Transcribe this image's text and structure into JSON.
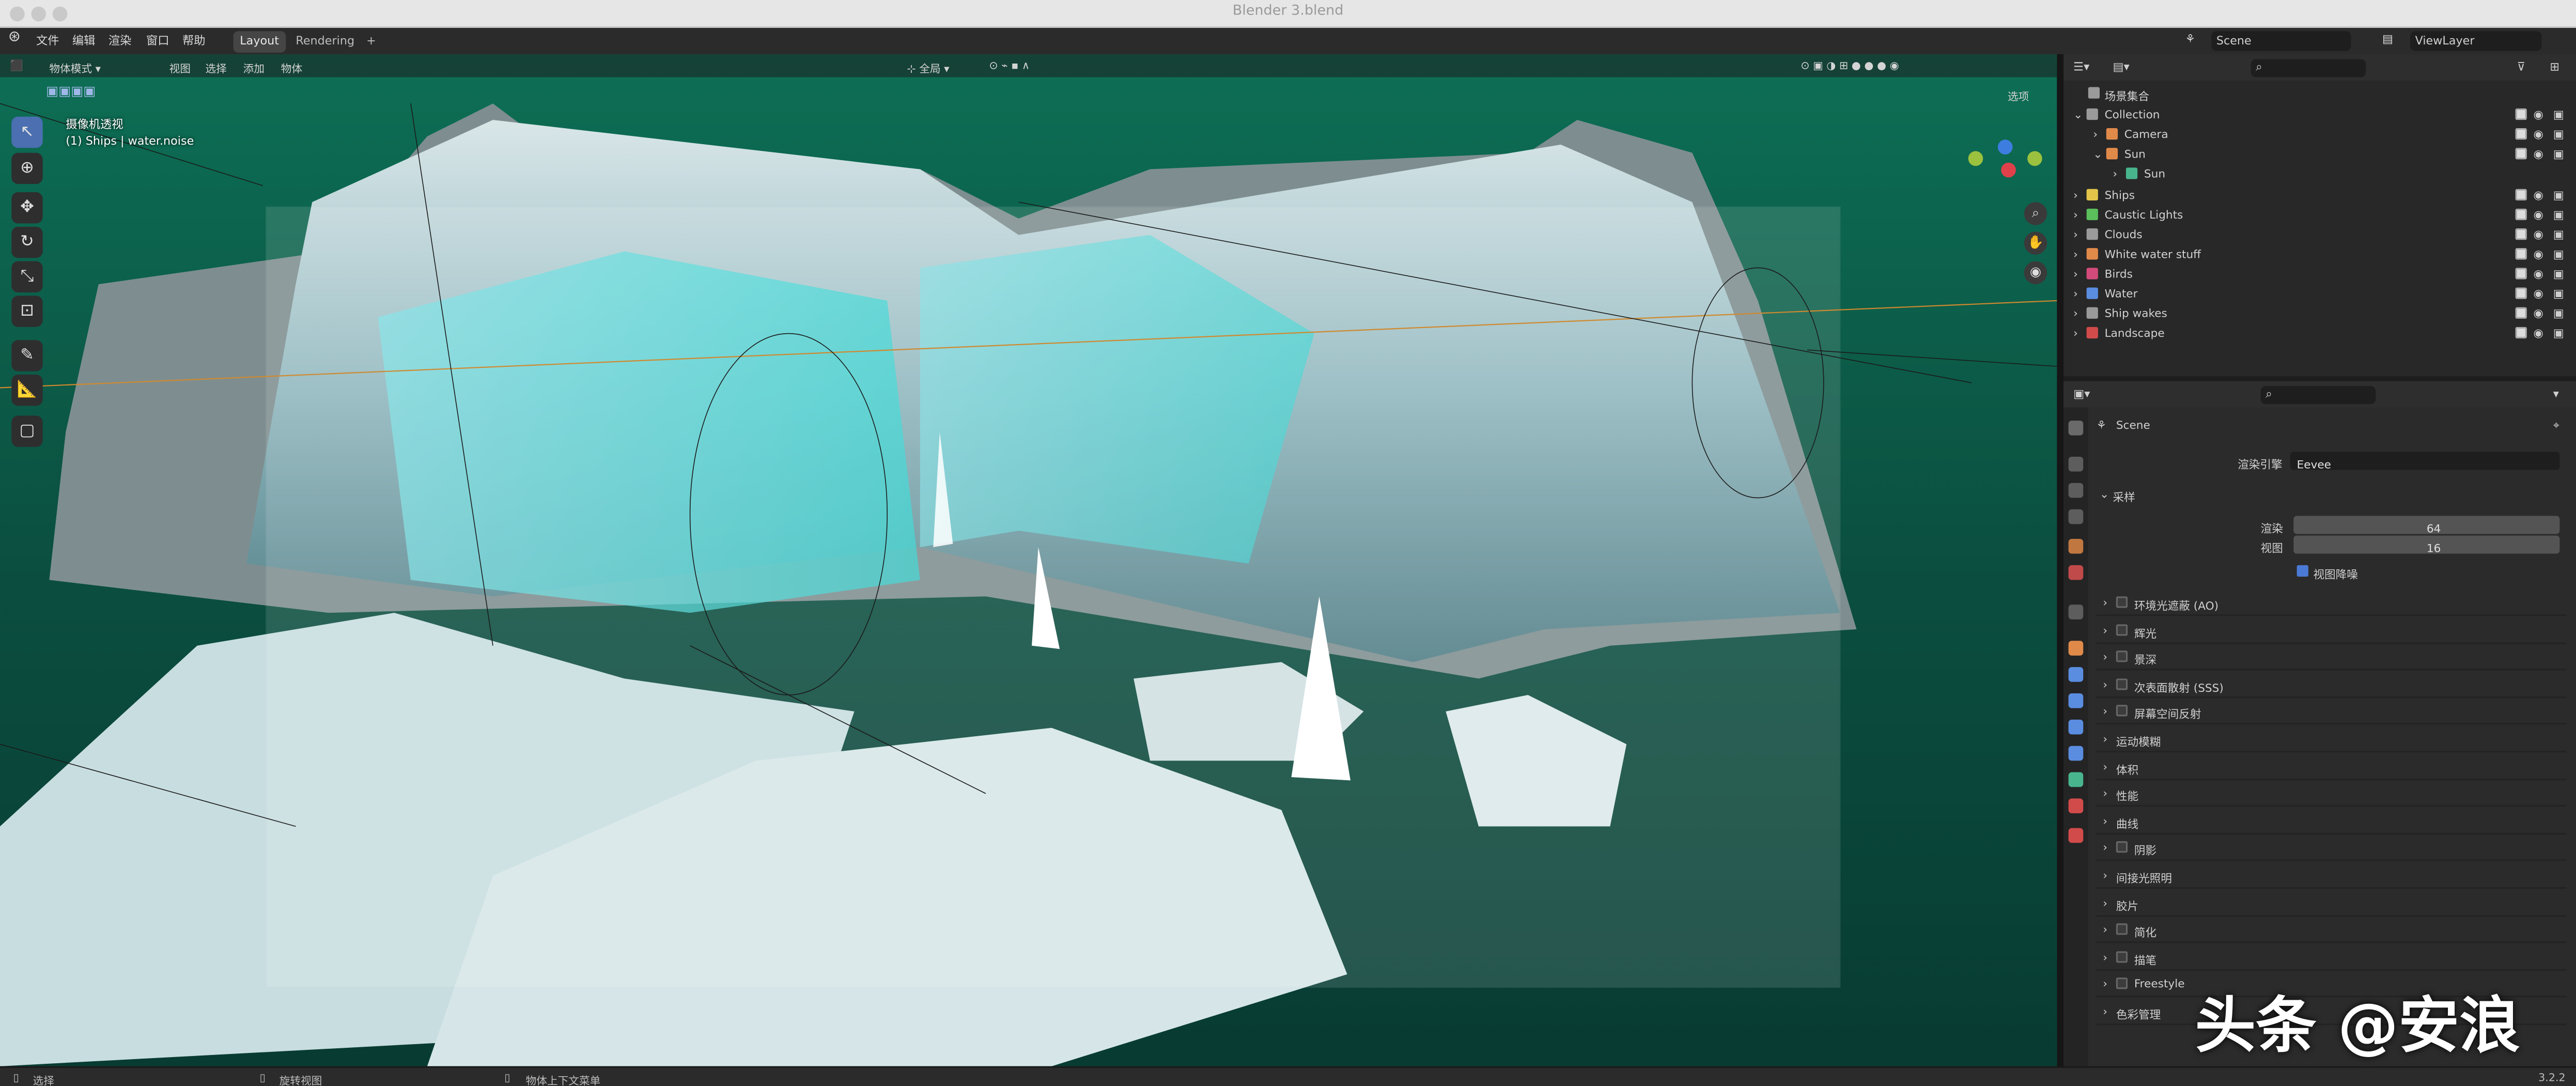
{
  "window": {
    "title": "Blender 3.blend"
  },
  "topbar": {
    "menus": [
      "文件",
      "编辑",
      "渲染",
      "窗口",
      "帮助"
    ],
    "tabs": [
      "Layout",
      "Rendering"
    ],
    "add_tab": "+",
    "scene": "Scene",
    "view_layer": "ViewLayer"
  },
  "viewport": {
    "header": {
      "mode": "物体模式",
      "menus": [
        "视图",
        "选择",
        "添加",
        "物体"
      ],
      "transform": "全局",
      "options": "选项"
    },
    "overlay_title": "摄像机透视",
    "overlay_sub": "(1) Ships | water.noise"
  },
  "outliner": {
    "root": "场景集合",
    "items": [
      {
        "name": "Collection",
        "color": "#9a9a9a"
      },
      {
        "name": "Camera",
        "color": "#e08a4a"
      },
      {
        "name": "Sun",
        "color": "#e08a4a"
      },
      {
        "name": "Sun",
        "color": "#48b58d"
      },
      {
        "name": "Ships",
        "color": "#e4c54a"
      },
      {
        "name": "Caustic Lights",
        "color": "#5bbf5b"
      },
      {
        "name": "Clouds",
        "color": "#9a9a9a"
      },
      {
        "name": "White water stuff",
        "color": "#e08a4a"
      },
      {
        "name": "Birds",
        "color": "#d24b7a"
      },
      {
        "name": "Water",
        "color": "#5a8de0"
      },
      {
        "name": "Ship wakes",
        "color": "#9a9a9a"
      },
      {
        "name": "Landscape",
        "color": "#d24b4b"
      }
    ]
  },
  "properties": {
    "scene": "Scene",
    "render_engine_label": "渲染引擎",
    "render_engine": "Eevee",
    "sampling": {
      "title": "采样",
      "render_label": "渲染",
      "render": "64",
      "viewport_label": "视图",
      "viewport": "16",
      "denoise": "视图降噪"
    },
    "panels": [
      "环境光遮蔽 (AO)",
      "辉光",
      "景深",
      "次表面散射 (SSS)",
      "屏幕空间反射",
      "运动模糊",
      "体积",
      "性能",
      "曲线",
      "阴影",
      "间接光照明",
      "胶片",
      "简化",
      "描笔",
      "Freestyle",
      "色彩管理"
    ]
  },
  "status": {
    "select": "选择",
    "rotate": "旋转视图",
    "context": "物体上下文菜单",
    "version": "3.2.2"
  },
  "watermark": "头条 @安浪"
}
